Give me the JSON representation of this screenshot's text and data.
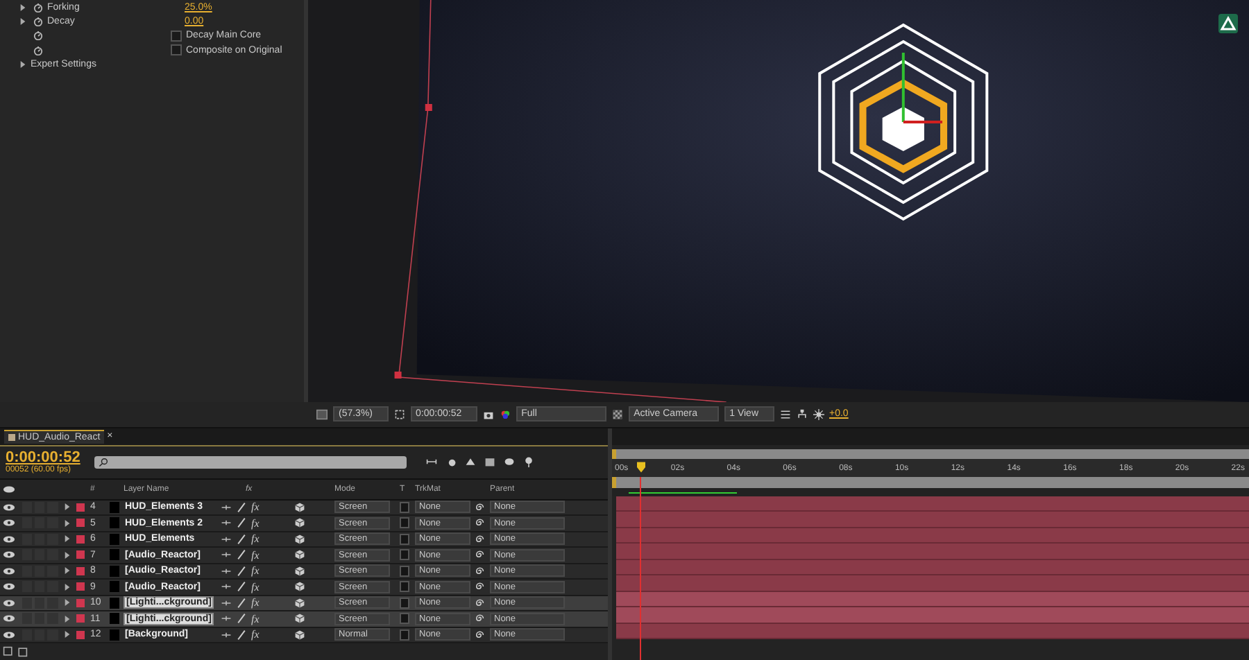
{
  "effect_controls": {
    "properties": [
      {
        "kind": "value",
        "label": "Forking",
        "value": "25.0%"
      },
      {
        "kind": "value",
        "label": "Decay",
        "value": "0.00"
      },
      {
        "kind": "checkbox",
        "label": "Decay Main Core",
        "checked": false
      },
      {
        "kind": "checkbox",
        "label": "Composite on Original",
        "checked": false
      },
      {
        "kind": "group",
        "label": "Expert Settings"
      }
    ]
  },
  "viewer": {
    "magnification": "(57.3%)",
    "timecode": "0:00:00:52",
    "resolution": "Full",
    "camera": "Active Camera",
    "views": "1 View",
    "exposure": "+0.0"
  },
  "timeline": {
    "tab": {
      "title": "HUD_Audio_React",
      "close": "×"
    },
    "timecode": "0:00:00:52",
    "frame_info": "00052 (60.00 fps)",
    "columns": {
      "number": "#",
      "layer_name": "Layer Name",
      "fx": "fx",
      "mode": "Mode",
      "t": "T",
      "trkmat": "TrkMat",
      "parent": "Parent"
    },
    "ruler": [
      "00s",
      "02s",
      "04s",
      "06s",
      "08s",
      "10s",
      "12s",
      "14s",
      "16s",
      "18s",
      "20s",
      "22s"
    ],
    "layers": [
      {
        "number": "4",
        "name": "HUD_Elements 3",
        "fx": "fx",
        "mode": "Screen",
        "trkmat": "None",
        "parent": "None",
        "selected": false
      },
      {
        "number": "5",
        "name": "HUD_Elements 2",
        "fx": "fx",
        "mode": "Screen",
        "trkmat": "None",
        "parent": "None",
        "selected": false
      },
      {
        "number": "6",
        "name": "HUD_Elements",
        "fx": "fx",
        "mode": "Screen",
        "trkmat": "None",
        "parent": "None",
        "selected": false
      },
      {
        "number": "7",
        "name": "[Audio_Reactor]",
        "fx": "fx",
        "mode": "Screen",
        "trkmat": "None",
        "parent": "None",
        "selected": false
      },
      {
        "number": "8",
        "name": "[Audio_Reactor]",
        "fx": "fx",
        "mode": "Screen",
        "trkmat": "None",
        "parent": "None",
        "selected": false
      },
      {
        "number": "9",
        "name": "[Audio_Reactor]",
        "fx": "fx",
        "mode": "Screen",
        "trkmat": "None",
        "parent": "None",
        "selected": false
      },
      {
        "number": "10",
        "name": "[Lighti...ckground]",
        "fx": "fx",
        "mode": "Screen",
        "trkmat": "None",
        "parent": "None",
        "selected": true
      },
      {
        "number": "11",
        "name": "[Lighti...ckground]",
        "fx": "fx",
        "mode": "Screen",
        "trkmat": "None",
        "parent": "None",
        "selected": true
      },
      {
        "number": "12",
        "name": "[Background]",
        "fx": "fx",
        "mode": "Normal",
        "trkmat": "None",
        "parent": "None",
        "selected": false
      }
    ]
  }
}
